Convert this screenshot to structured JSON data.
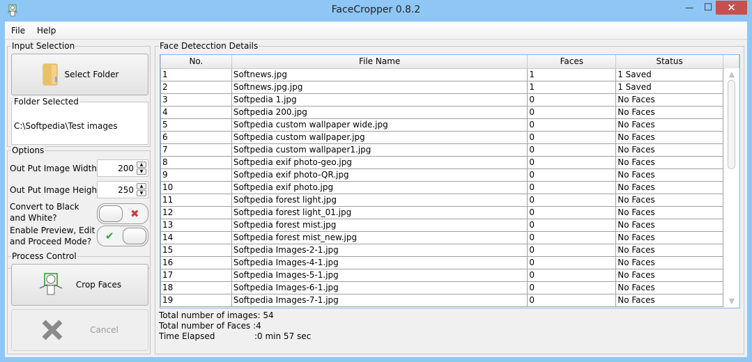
{
  "window": {
    "title": "FaceCropper 0.8.2",
    "minimize_glyph": "—",
    "maximize_glyph": "☐",
    "close_glyph": "✕"
  },
  "menu": {
    "items": [
      {
        "label": "File"
      },
      {
        "label": "Help"
      }
    ]
  },
  "input_selection": {
    "group_label": "Input Selection",
    "select_folder_label": "Select Folder",
    "folder_selected_label": "Folder Selected",
    "folder_path": "C:\\Softpedia\\Test images"
  },
  "options": {
    "group_label": "Options",
    "width_label": "Out Put Image Width",
    "width_value": "200",
    "height_label": "Out Put Image Height",
    "height_value": "250",
    "bw_label": "Convert to Black and White?",
    "bw_enabled": false,
    "preview_label": "Enable Preview, Edit and Proceed Mode?",
    "preview_enabled": true,
    "off_glyph": "✖",
    "on_glyph": "✔"
  },
  "process_control": {
    "group_label": "Process Control",
    "crop_label": "Crop Faces",
    "cancel_label": "Cancel"
  },
  "details": {
    "group_label": "Face Detecction Details",
    "columns": [
      "No.",
      "File Name",
      "Faces",
      "Status"
    ],
    "rows": [
      [
        "1",
        "Softnews.jpg",
        "1",
        "1 Saved"
      ],
      [
        "2",
        "Softnews.jpg.jpg",
        "1",
        "1 Saved"
      ],
      [
        "3",
        "Softpedia 1.jpg",
        "0",
        "No Faces"
      ],
      [
        "4",
        "Softpedia 200.jpg",
        "0",
        "No Faces"
      ],
      [
        "5",
        "Softpedia custom wallpaper wide.jpg",
        "0",
        "No Faces"
      ],
      [
        "6",
        "Softpedia custom wallpaper.jpg",
        "0",
        "No Faces"
      ],
      [
        "7",
        "Softpedia custom wallpaper1.jpg",
        "0",
        "No Faces"
      ],
      [
        "8",
        "Softpedia exif photo-geo.jpg",
        "0",
        "No Faces"
      ],
      [
        "9",
        "Softpedia exif photo-QR.jpg",
        "0",
        "No Faces"
      ],
      [
        "10",
        "Softpedia exif photo.jpg",
        "0",
        "No Faces"
      ],
      [
        "11",
        "Softpedia forest light.jpg",
        "0",
        "No Faces"
      ],
      [
        "12",
        "Softpedia forest light_01.jpg",
        "0",
        "No Faces"
      ],
      [
        "13",
        "Softpedia forest mist.jpg",
        "0",
        "No Faces"
      ],
      [
        "14",
        "Softpedia forest mist_new.jpg",
        "0",
        "No Faces"
      ],
      [
        "15",
        "Softpedia Images-2-1.jpg",
        "0",
        "No Faces"
      ],
      [
        "16",
        "Softpedia Images-4-1.jpg",
        "0",
        "No Faces"
      ],
      [
        "17",
        "Softpedia Images-5-1.jpg",
        "0",
        "No Faces"
      ],
      [
        "18",
        "Softpedia Images-6-1.jpg",
        "0",
        "No Faces"
      ],
      [
        "19",
        "Softpedia Images-7-1.jpg",
        "0",
        "No Faces"
      ]
    ],
    "total_images": "Total number of images: 54",
    "total_faces": "Total number of Faces  :4",
    "time_elapsed_label": "Time Elapsed",
    "time_elapsed_value": ":0 min 57 sec"
  },
  "colors": {
    "titlebar": "#8ec7f5",
    "close": "#c7504f",
    "check": "#2fa12f",
    "cross": "#d23a3a"
  }
}
